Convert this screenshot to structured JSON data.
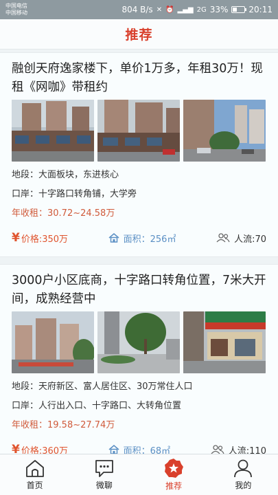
{
  "status": {
    "carrier1": "中国电信",
    "carrier2": "中国移动",
    "speed": "804 B/s",
    "signal_labels": "2G",
    "battery": "33%",
    "time": "20:11"
  },
  "header": {
    "title": "推荐"
  },
  "listings": [
    {
      "title": "融创天府逸家楼下，单价1万多，年租30万！现租《网咖》带租约",
      "location": "地段：大面板块，东进核心",
      "frontage": "口岸：十字路口转角铺，大学旁",
      "rent": "年收租：30.72~24.58万",
      "price": "价格:350万",
      "area": "面积：256㎡",
      "traffic": "人流:70"
    },
    {
      "title": "3000户小区底商，十字路口转角位置，7米大开间，成熟经营中",
      "location": "地段：天府新区、富人居住区、30万常住人口",
      "frontage": "口岸：人行出入口、十字路口、大转角位置",
      "rent": "年收租：19.58~27.74万",
      "price": "价格:360万",
      "area": "面积：68㎡",
      "traffic": "人流:110"
    }
  ],
  "tabs": [
    {
      "label": "首页",
      "icon": "home-icon"
    },
    {
      "label": "微聊",
      "icon": "chat-icon"
    },
    {
      "label": "推荐",
      "icon": "recommend-icon"
    },
    {
      "label": "我的",
      "icon": "profile-icon"
    }
  ],
  "colors": {
    "accent": "#d9402c",
    "area_blue": "#5a8fc4",
    "price_orange": "#e0542e"
  }
}
